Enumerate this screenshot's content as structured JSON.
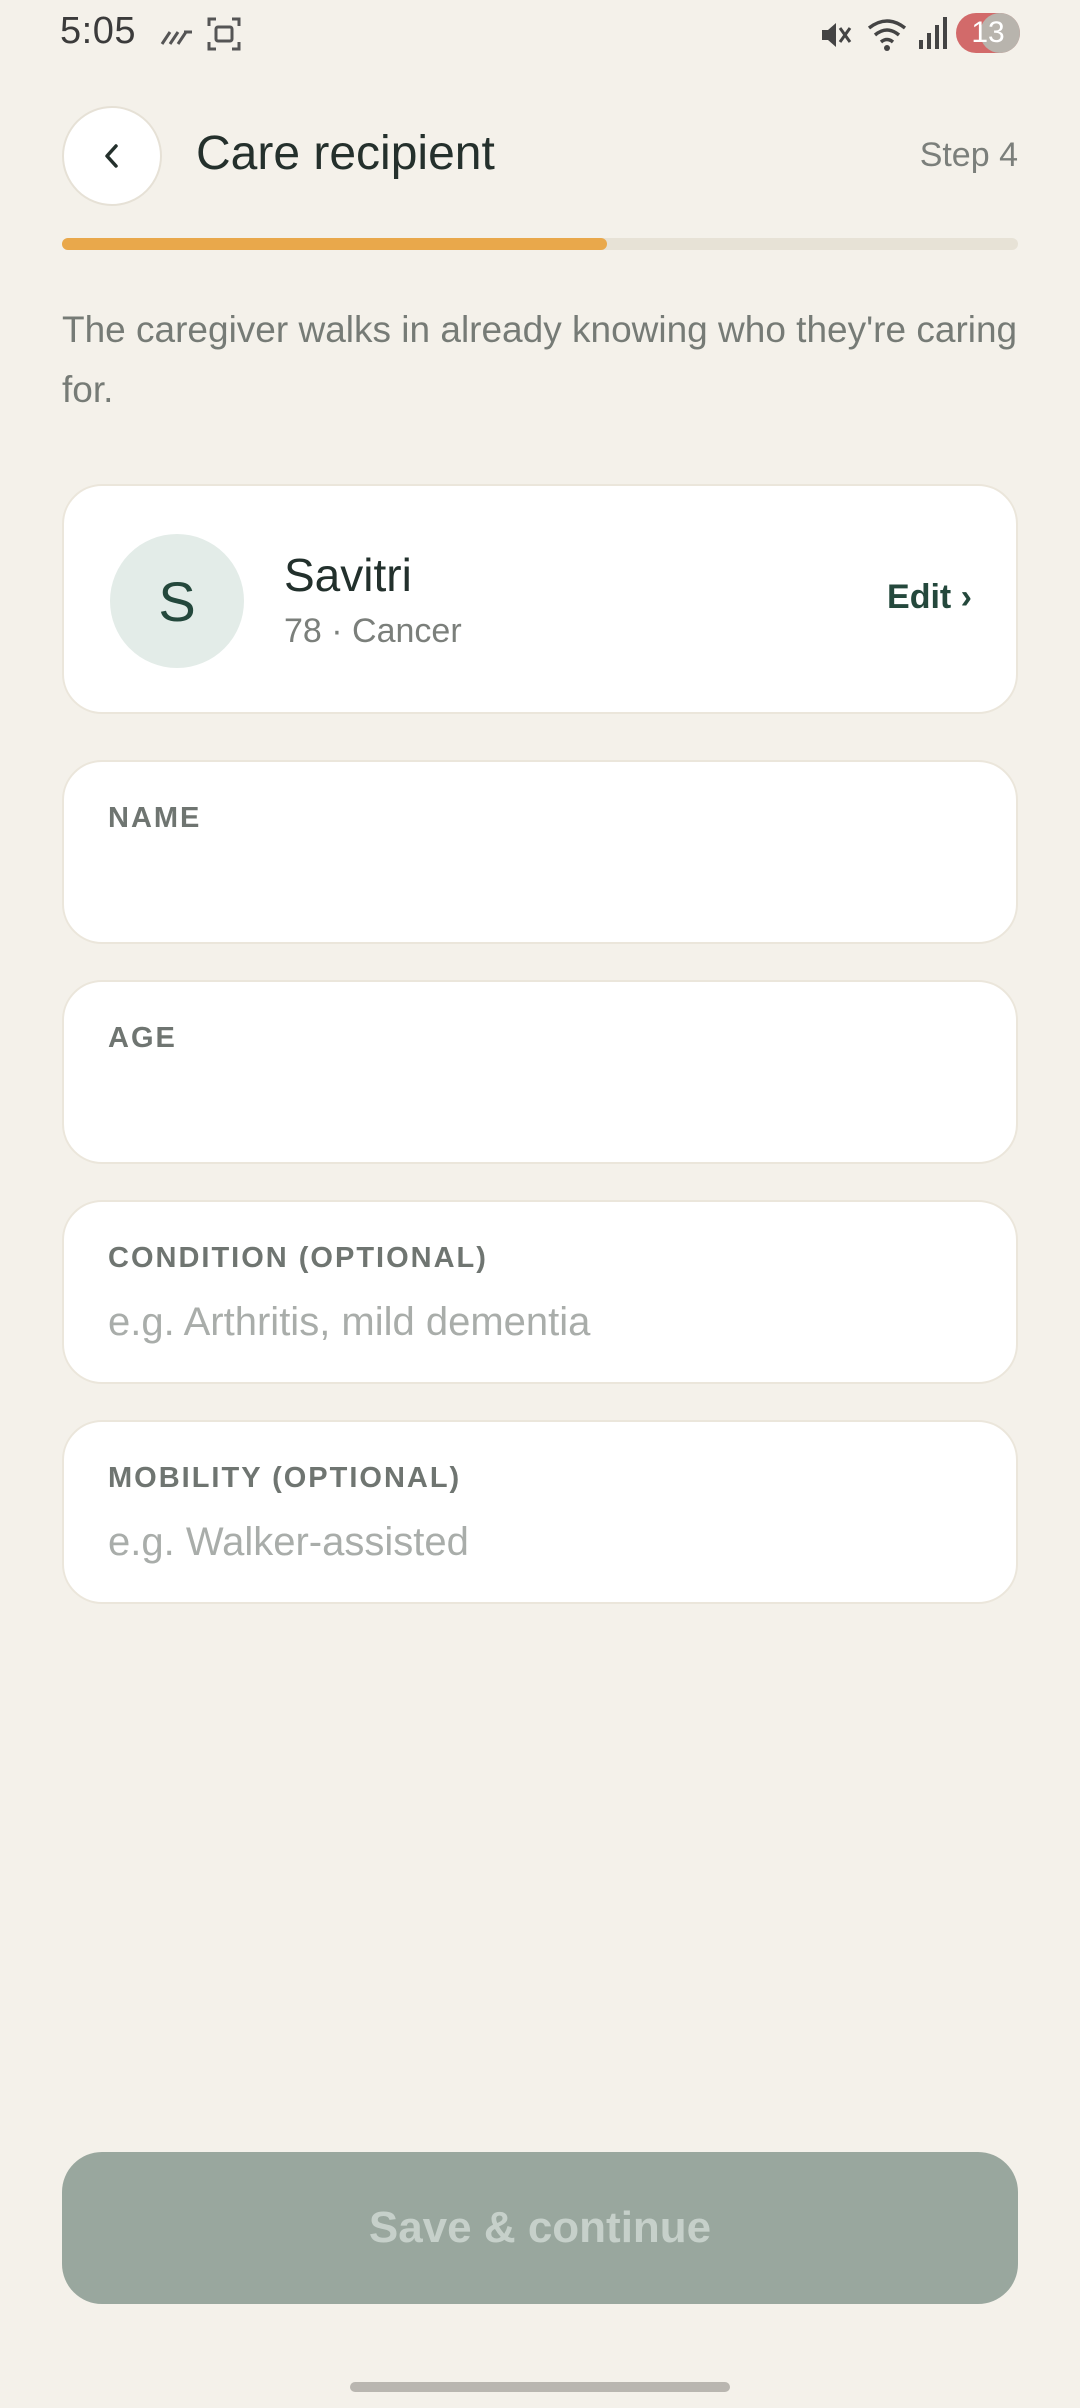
{
  "status_bar": {
    "time": "5:05",
    "notification_count": "13",
    "icons": [
      "missed-call-icon",
      "screenshot-icon",
      "mute-icon",
      "wifi-icon",
      "signal-icon"
    ]
  },
  "header": {
    "back_icon": "chevron-left-icon",
    "title": "Care recipient",
    "step": "Step 4",
    "progress": 0.57
  },
  "subtitle": "The caregiver walks in already knowing who they're caring for.",
  "recipient": {
    "initial": "S",
    "name": "Savitri",
    "meta": "78 · Cancer",
    "edit_label": "Edit ›"
  },
  "fields": {
    "name": {
      "label": "NAME",
      "value": "",
      "placeholder": ""
    },
    "age": {
      "label": "AGE",
      "value": "",
      "placeholder": ""
    },
    "condition": {
      "label": "CONDITION (OPTIONAL)",
      "value": "",
      "placeholder": "e.g. Arthritis, mild dementia"
    },
    "mobility": {
      "label": "MOBILITY (OPTIONAL)",
      "value": "",
      "placeholder": "e.g. Walker-assisted"
    }
  },
  "save_button": {
    "label": "Save & continue"
  },
  "colors": {
    "background": "#f4f1ea",
    "accent_progress": "#e9a84b",
    "primary_dark": "#24483c",
    "button_disabled": "#99a79e"
  }
}
